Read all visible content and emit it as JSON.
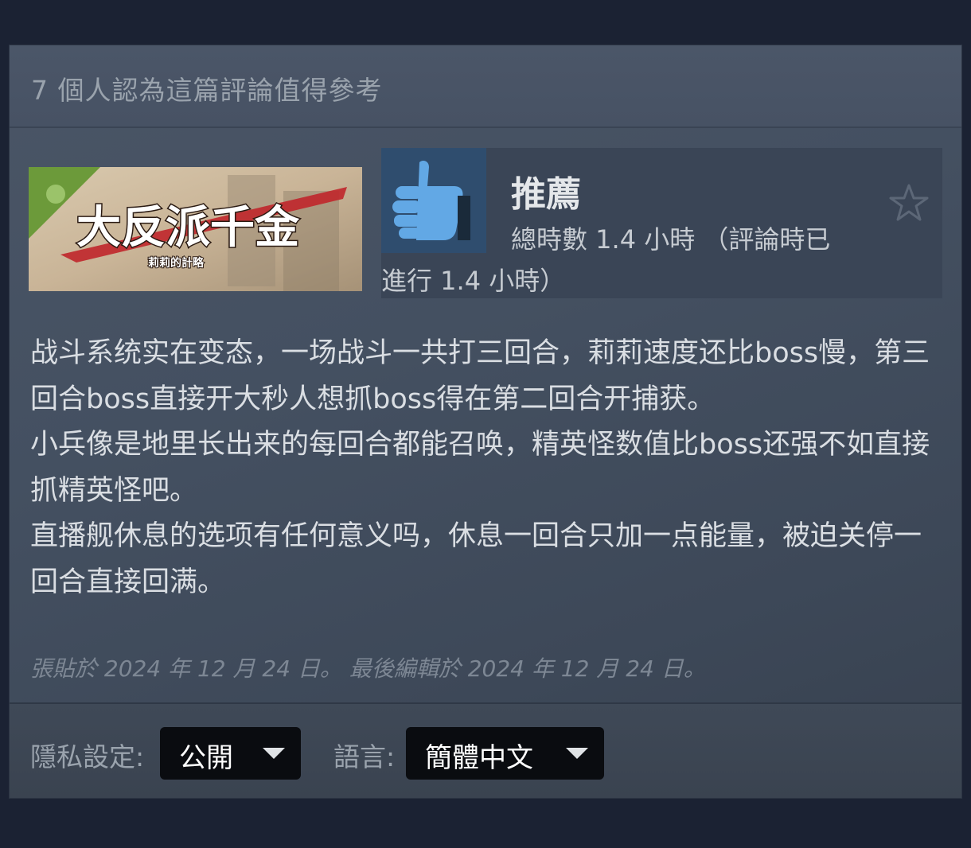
{
  "helpful": {
    "text": "7 個人認為這篇評論值得參考"
  },
  "game": {
    "title_art": "大反派千金",
    "subtitle_art": "莉莉的計略"
  },
  "recommendation": {
    "label": "推薦",
    "hours_line1": "總時數 1.4 小時 （評論時已",
    "hours_line2": "進行 1.4 小時）"
  },
  "review": {
    "paragraphs": [
      "战斗系统实在变态，一场战斗一共打三回合，莉莉速度还比boss慢，第三回合boss直接开大秒人想抓boss得在第二回合开捕获。",
      "小兵像是地里长出来的每回合都能召唤，精英怪数值比boss还强不如直接抓精英怪吧。",
      "直播舰休息的选项有任何意义吗，休息一回合只加一点能量，被迫关停一回合直接回满。"
    ],
    "posted": "張貼於 2024 年 12 月 24 日。 最後編輯於 2024 年 12 月 24 日。"
  },
  "settings": {
    "privacy_label": "隱私設定:",
    "privacy_value": "公開",
    "language_label": "語言:",
    "language_value": "簡體中文"
  },
  "colors": {
    "page_bg": "#1b2233",
    "card_bg": "#445061",
    "thumb_blue": "#62a8e5",
    "select_bg": "#0a0c10"
  }
}
